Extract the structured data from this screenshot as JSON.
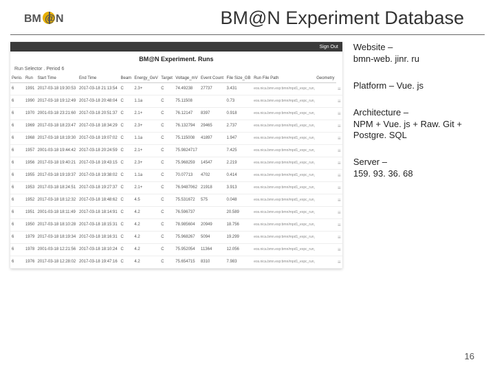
{
  "header": {
    "title": "BM@N Experiment Database"
  },
  "app": {
    "signout": "Sign Out",
    "title": "BM@N Experiment. Runs",
    "run_selector_label": "Run Selector .",
    "period_label": "Period 6",
    "columns": [
      "Perio.",
      "Run",
      "Start Time",
      "End Time",
      "Beam",
      "Energy_GeV",
      "Target",
      "Voltage_mV",
      "Event Count",
      "File Size_GB",
      "Run File Path",
      "Geometry"
    ],
    "rows": [
      [
        "6",
        "1991",
        "2017-03-18 19:30:53",
        "2017-03-18 21:13:54",
        "C",
        "2.3+",
        "C",
        "74.49238",
        "27737",
        "3.431",
        "eos.nica.bmn.exp:bmn/mpd1_expc_run_Glob_",
        ""
      ],
      [
        "6",
        "1990",
        "2017-03-18 19:12:49",
        "2017-03-18 20:48:04",
        "C",
        "1.1a",
        "C",
        "75.11508",
        "",
        "0.73",
        "eos.nica.bmn.exp:bmn/mpd1_expc_run_GA_e.",
        ""
      ],
      [
        "6",
        "1970",
        "2001-03-18 23:21:60",
        "2017-03-18 20:51:37",
        "C",
        "2.1+",
        "C",
        "76.12147",
        "8397",
        "0.918",
        "eos.nica.bmn.exp:bmn/mpd1_expc_run_Glob_",
        ""
      ],
      [
        "6",
        "1969",
        "2017-03-18 18:23:47",
        "2017-03-18 18:34:29",
        "C",
        "2.3+",
        "C",
        "76.132794",
        "29465",
        "2.737",
        "eos.nica.bmn.exp:bmn/mpd1_expc_run_Glob_",
        ""
      ],
      [
        "6",
        "1968",
        "2017-03-18 18:19:30",
        "2017-03-18 19:07:02",
        "C",
        "1.1a",
        "C",
        "75.115008",
        "41897",
        "1.947",
        "eos.nica.bmn.exp:bmn/mpd1_expc_run_Glob_",
        ""
      ],
      [
        "6",
        "1957",
        "2001-03-18 19:44:42",
        "2017-03-18 20:24:59",
        "C",
        "2.1+",
        "C",
        "75.9824717",
        "",
        "7.425",
        "eos.nica.bmn.exp:bmn/mpd1_expc_run_Glob_",
        ""
      ],
      [
        "6",
        "1956",
        "2017-03-18 19:40:21",
        "2017-03-18 19:43:15",
        "C",
        "2.3+",
        "C",
        "75.968259",
        "14547",
        "2.219",
        "eos.nica.bmn.exp:bmn/mpd1_expc_run_Glob_",
        ""
      ],
      [
        "6",
        "1955",
        "2017-03-18 19:19:37",
        "2017-03-18 19:38:02",
        "C",
        "1.1a",
        "C",
        "70.07713",
        "4702",
        "0.414",
        "eos.nica.bmn.exp:bmn/mpd1_expc_run_Glob_",
        ""
      ],
      [
        "6",
        "1953",
        "2017-03-18 18:24:51",
        "2017-03-18 19:27:37",
        "C",
        "2.1+",
        "C",
        "76.9487062",
        "21918",
        "3.913",
        "eos.nica.bmn.exp:bmn/mpd1_expc_run_Glob_",
        ""
      ],
      [
        "6",
        "1952",
        "2017-03-18 18:12:32",
        "2017-03-18 18:48:62",
        "C",
        "4.5",
        "C",
        "75.531672",
        "575",
        "0.048",
        "eos.nica.bmn.exp:bmn/mpd1_expc_run_Glob_",
        ""
      ],
      [
        "6",
        "1951",
        "2001-03-18 18:11:49",
        "2017-03-18 18:14:91",
        "C",
        "4.2",
        "C",
        "76.596737",
        "",
        "20.589",
        "eos.nica.bmn.exp:bmn/mpd1_expc_run_Glob_",
        ""
      ],
      [
        "6",
        "1950",
        "2017-03-18 18:10:28",
        "2017-03-18 18:15:31",
        "C",
        "4.2",
        "C",
        "78.985604",
        "20949",
        "18.756",
        "eos.nica.bmn.exp:bmn/mpd1_expc_run_Glob_",
        ""
      ],
      [
        "6",
        "1979",
        "2017-03-18 18:19:34",
        "2017-03-18 18:16:31",
        "C",
        "4.2",
        "C",
        "75.968267",
        "5094",
        "19.299",
        "eos.nica.bmn.exp:bmn/mpd1_expc_run_Glob_",
        ""
      ],
      [
        "6",
        "1978",
        "2001-03-18 12:21:56",
        "2017-03-18 18:10:24",
        "C",
        "4.2",
        "C",
        "75.952054",
        "11364",
        "12.056",
        "eos.nica.bmn.exp:bmn/mpd1_expc_run_Glob_",
        ""
      ],
      [
        "6",
        "1976",
        "2017-03-18 12:28:02",
        "2017-03-18 19:47:16",
        "C",
        "4.2",
        "C",
        "75.654715",
        "8310",
        "7.983",
        "eos.nica.bmn.exp:bmn/mpd1_expc_run_Glob_",
        ""
      ]
    ]
  },
  "notes": {
    "website_label": "Website –",
    "website_value": "bmn-web. jinr. ru",
    "platform_label": "Platform – Vue. js",
    "arch_l1": "Architecture –",
    "arch_l2": "NPM + Vue. js + Raw. Git +",
    "arch_l3": "Postgre. SQL",
    "server_l1": "Server –",
    "server_l2": "159. 93. 36. 68"
  },
  "page_number": "16"
}
